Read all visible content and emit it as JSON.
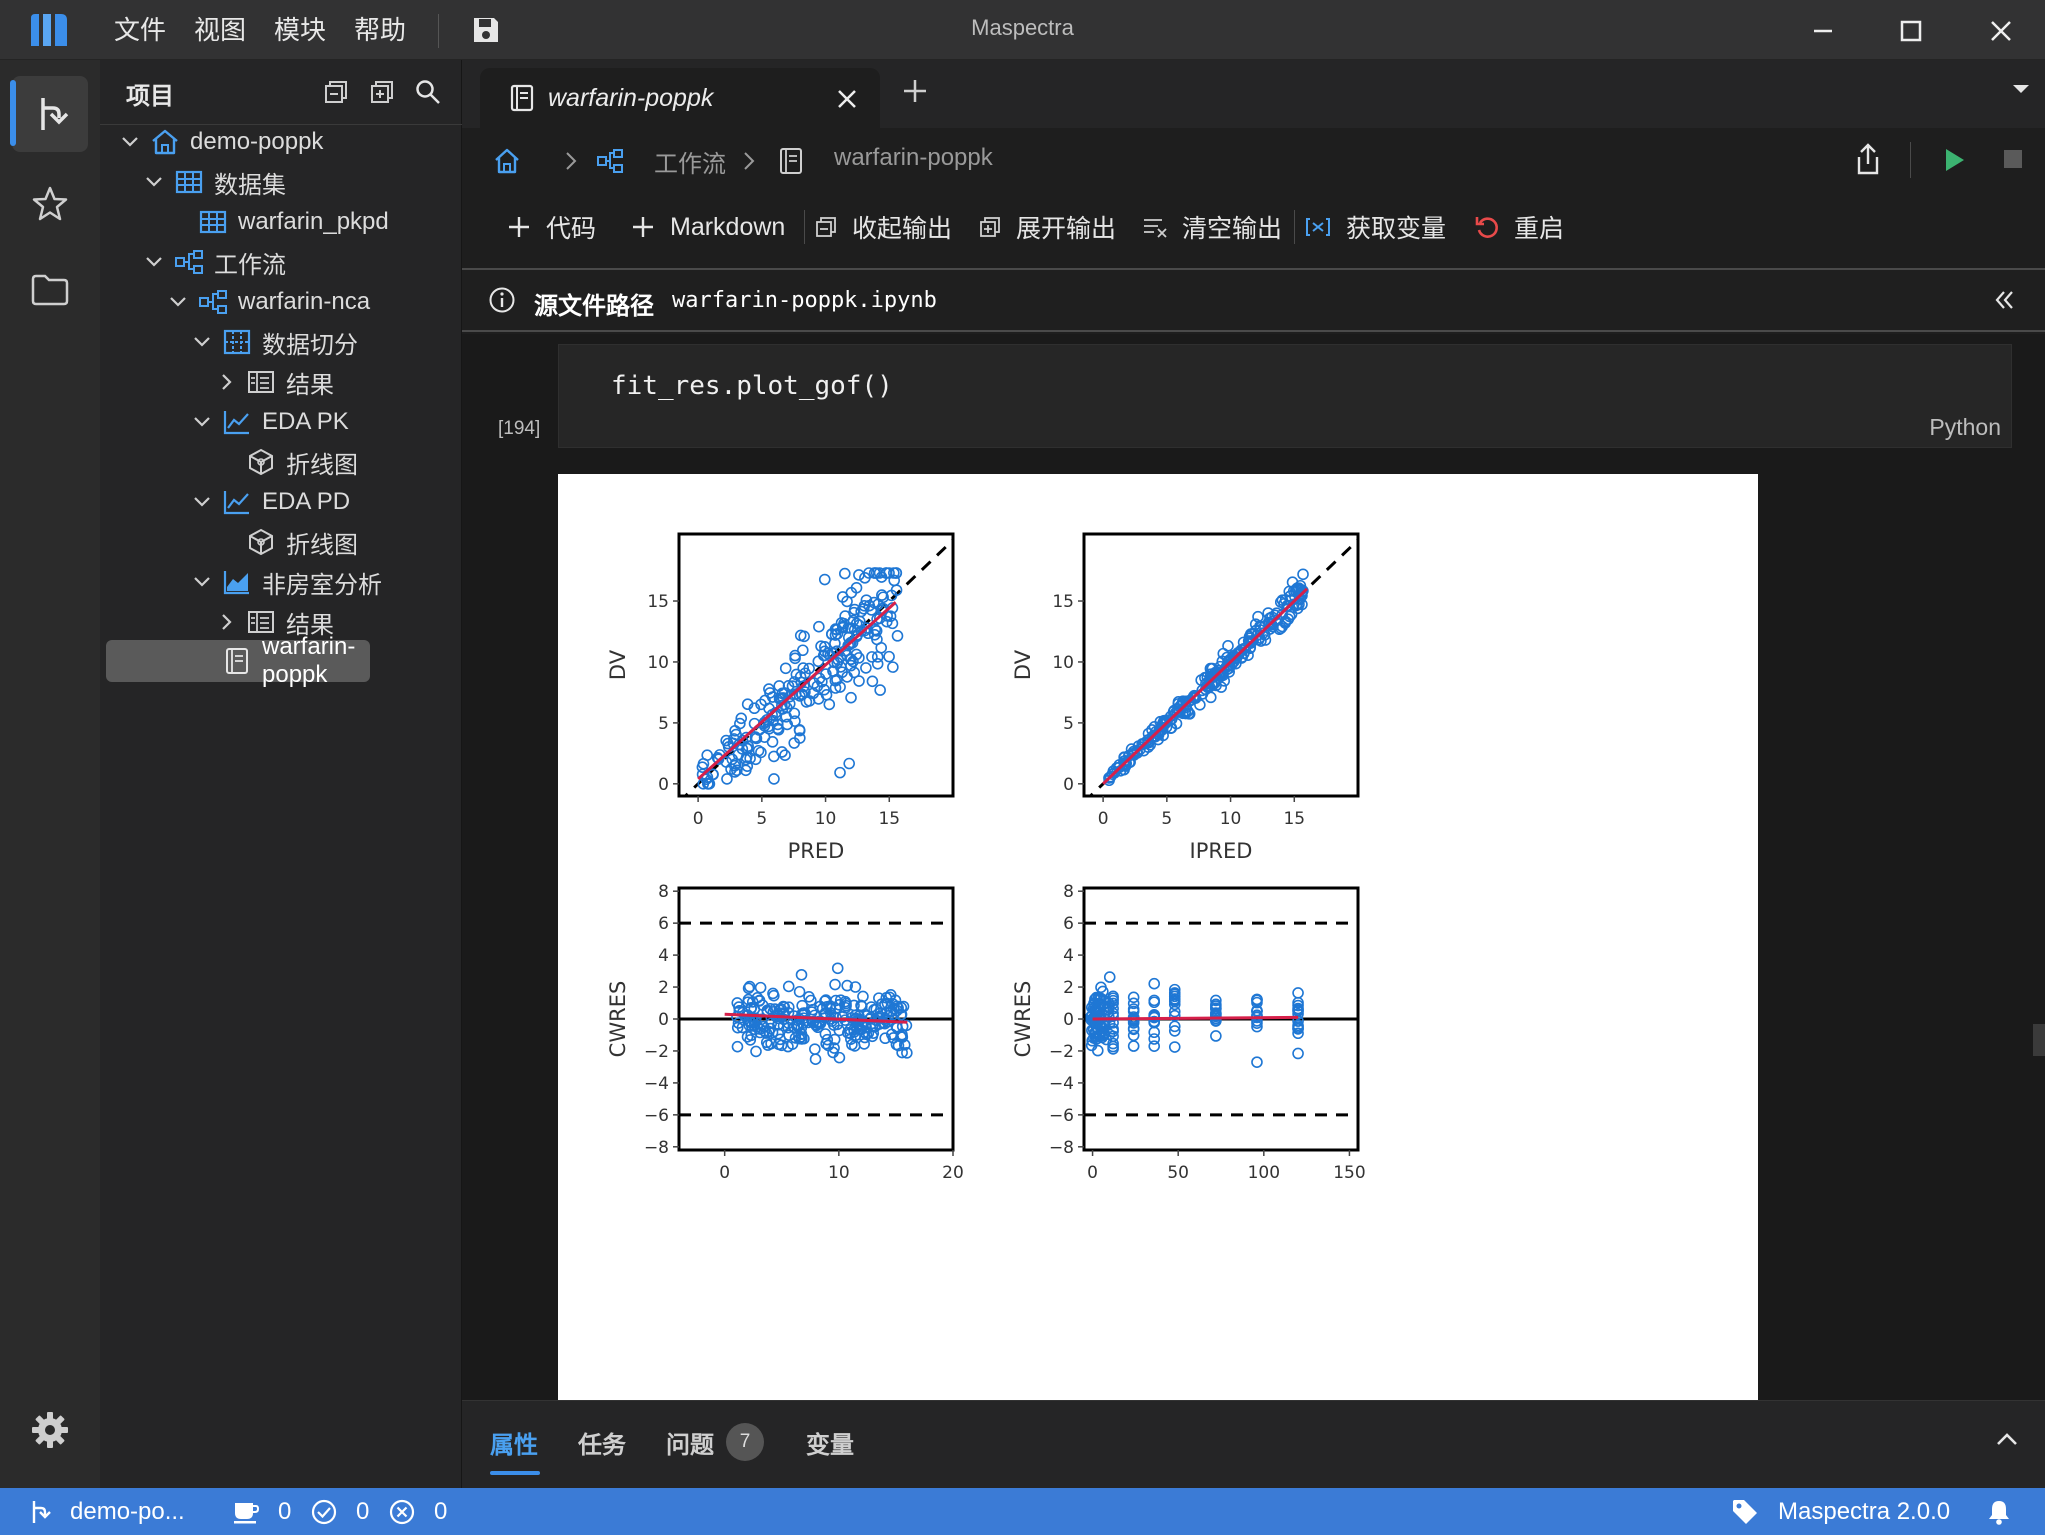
{
  "app": {
    "title": "Maspectra",
    "version_label": "Maspectra 2.0.0"
  },
  "menu": [
    "文件",
    "视图",
    "模块",
    "帮助"
  ],
  "sidebar": {
    "title": "项目",
    "tree": [
      {
        "label": "demo-poppk",
        "icon": "home-icon",
        "expanded": true
      },
      {
        "label": "数据集",
        "icon": "table-icon",
        "expanded": true
      },
      {
        "label": "warfarin_pkpd",
        "icon": "table-icon"
      },
      {
        "label": "工作流",
        "icon": "workflow-icon",
        "expanded": true
      },
      {
        "label": "warfarin-nca",
        "icon": "workflow-icon",
        "expanded": true
      },
      {
        "label": "数据切分",
        "icon": "split-icon",
        "expanded": true
      },
      {
        "label": "结果",
        "icon": "result-icon",
        "expanded": false
      },
      {
        "label": "EDA PK",
        "icon": "line-chart-icon",
        "expanded": true
      },
      {
        "label": "折线图",
        "icon": "cube-icon"
      },
      {
        "label": "EDA PD",
        "icon": "line-chart-icon",
        "expanded": true
      },
      {
        "label": "折线图",
        "icon": "cube-icon"
      },
      {
        "label": "非房室分析",
        "icon": "area-chart-icon",
        "expanded": true
      },
      {
        "label": "结果",
        "icon": "result-icon",
        "expanded": false
      },
      {
        "label": "warfarin-poppk",
        "icon": "notebook-icon",
        "selected": true
      }
    ]
  },
  "tab": {
    "label": "warfarin-poppk"
  },
  "breadcrumb": {
    "workflow": "工作流",
    "notebook": "warfarin-poppk"
  },
  "toolbar": {
    "add_code": "代码",
    "add_markdown": "Markdown",
    "collapse_output": "收起输出",
    "expand_output": "展开输出",
    "clear_output": "清空输出",
    "get_variables": "获取变量",
    "restart": "重启"
  },
  "source": {
    "label": "源文件路径",
    "path": "warfarin-poppk.ipynb"
  },
  "cell": {
    "code": "fit_res.plot_gof()",
    "language": "Python",
    "execution_count": "[194]"
  },
  "bottom_tabs": {
    "properties": "属性",
    "tasks": "任务",
    "problems": "问题",
    "problems_count": "7",
    "variables": "变量"
  },
  "status": {
    "project": "demo-po...",
    "cups": "0",
    "ok": "0",
    "errors": "0"
  },
  "colors": {
    "accent": "#3b8eea",
    "status_bar": "#3b7bd6",
    "marker": "#1f77d4",
    "smooth_line": "#d6204a",
    "run": "#3cb371"
  },
  "chart_data": [
    {
      "type": "scatter",
      "xlabel": "PRED",
      "ylabel": "DV",
      "xlim": [
        -1.5,
        20
      ],
      "ylim": [
        -1,
        20.5
      ],
      "xticks": [
        0,
        5,
        10,
        15
      ],
      "yticks": [
        0,
        5,
        10,
        15
      ],
      "reference_line": "identity (dashed)",
      "smooth_line": {
        "x": [
          0,
          15.5
        ],
        "y": [
          0.4,
          14.9
        ]
      },
      "points_summary": "≈270 observations, DV ≈ PRED with spread, range 0–17"
    },
    {
      "type": "scatter",
      "xlabel": "IPRED",
      "ylabel": "DV",
      "xlim": [
        -1.5,
        20
      ],
      "ylim": [
        -1,
        20.5
      ],
      "xticks": [
        0,
        5,
        10,
        15
      ],
      "yticks": [
        0,
        5,
        10,
        15
      ],
      "reference_line": "identity (dashed)",
      "smooth_line": {
        "x": [
          0,
          16
        ],
        "y": [
          0,
          16
        ]
      },
      "points_summary": "≈270 observations tightly along identity, range 0–17"
    },
    {
      "type": "scatter",
      "xlabel": "",
      "ylabel": "CWRES",
      "xlim": [
        -4,
        20
      ],
      "ylim": [
        -8.2,
        8.2
      ],
      "xticks": [
        0,
        10,
        20
      ],
      "yticks": [
        -8,
        -6,
        -4,
        -2,
        0,
        2,
        4,
        6,
        8
      ],
      "hlines": [
        {
          "y": 0,
          "style": "solid"
        },
        {
          "y": 6,
          "style": "dashed"
        },
        {
          "y": -6,
          "style": "dashed"
        }
      ],
      "smooth_line": {
        "x": [
          0,
          16
        ],
        "y": [
          0.3,
          -0.2
        ]
      },
      "points_summary": "≈270 residuals, x 0–16, CWRES mostly within −3 to 3.5"
    },
    {
      "type": "scatter",
      "xlabel": "",
      "ylabel": "CWRES",
      "xlim": [
        -5,
        155
      ],
      "ylim": [
        -8.2,
        8.2
      ],
      "xticks": [
        0,
        50,
        100,
        150
      ],
      "yticks": [
        -8,
        -6,
        -4,
        -2,
        0,
        2,
        4,
        6,
        8
      ],
      "time_groups": [
        0,
        1,
        2,
        3,
        4,
        6,
        9,
        12,
        24,
        36,
        48,
        72,
        96,
        120
      ],
      "hlines": [
        {
          "y": 0,
          "style": "solid"
        },
        {
          "y": 6,
          "style": "dashed"
        },
        {
          "y": -6,
          "style": "dashed"
        }
      ],
      "smooth_line": {
        "x": [
          0,
          120
        ],
        "y": [
          0.0,
          0.1
        ]
      },
      "points_summary": "residuals grouped at sampling times, CWRES mostly within −3 to 3.5"
    }
  ]
}
